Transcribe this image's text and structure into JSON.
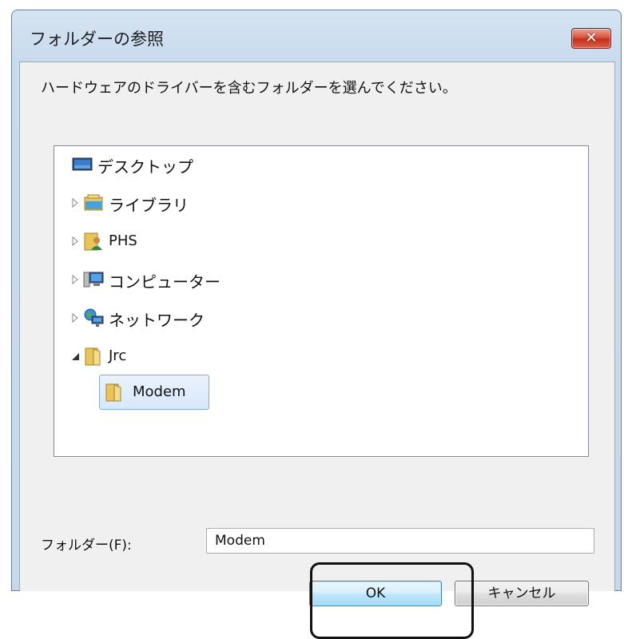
{
  "dialog": {
    "title": "フォルダーの参照",
    "close_icon": "close-icon",
    "instruction": "ハードウェアのドライバーを含むフォルダーを選んでください。"
  },
  "tree": {
    "items": [
      {
        "label": "デスクトップ",
        "icon": "desktop-icon",
        "expander": "none"
      },
      {
        "label": "ライブラリ",
        "icon": "library-icon",
        "expander": "collapsed"
      },
      {
        "label": "PHS",
        "icon": "user-folder-icon",
        "expander": "collapsed"
      },
      {
        "label": "コンピューター",
        "icon": "computer-icon",
        "expander": "collapsed"
      },
      {
        "label": "ネットワーク",
        "icon": "network-icon",
        "expander": "collapsed"
      },
      {
        "label": "Jrc",
        "icon": "folder-icon",
        "expander": "expanded"
      },
      {
        "label": "Modem",
        "icon": "folder-icon",
        "expander": "none",
        "selected": true
      }
    ]
  },
  "folder_field": {
    "label": "フォルダー(F):",
    "value": "Modem"
  },
  "buttons": {
    "ok": "OK",
    "cancel": "キャンセル"
  },
  "colors": {
    "selection_border": "#84acdd",
    "close_button": "#c5301c",
    "ok_border": "#3c7fb1"
  }
}
